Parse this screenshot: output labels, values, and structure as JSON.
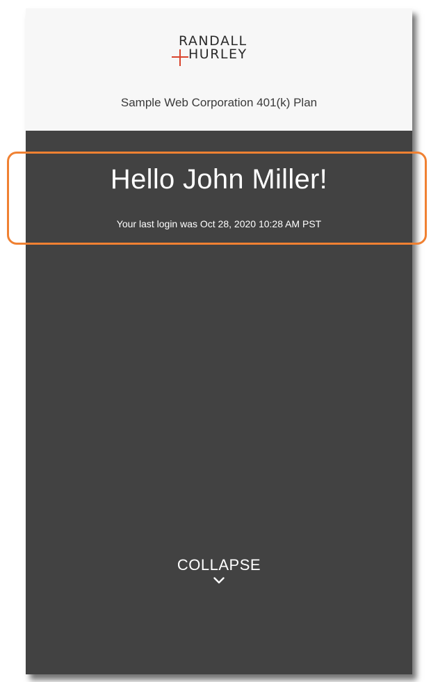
{
  "header": {
    "logo": {
      "line1": "RANDALL",
      "line2": "HURLEY",
      "mark_color": "#d9432b"
    },
    "plan_name": "Sample Web Corporation 401(k) Plan"
  },
  "welcome": {
    "greeting": "Hello John Miller!",
    "last_login": "Your last login was Oct 28, 2020 10:28 AM PST"
  },
  "collapse": {
    "label": "COLLAPSE",
    "icon": "chevron-down-icon"
  },
  "colors": {
    "header_bg": "#f7f7f7",
    "panel_bg": "#424242",
    "highlight": "#f08132",
    "text_light": "#ffffff"
  }
}
